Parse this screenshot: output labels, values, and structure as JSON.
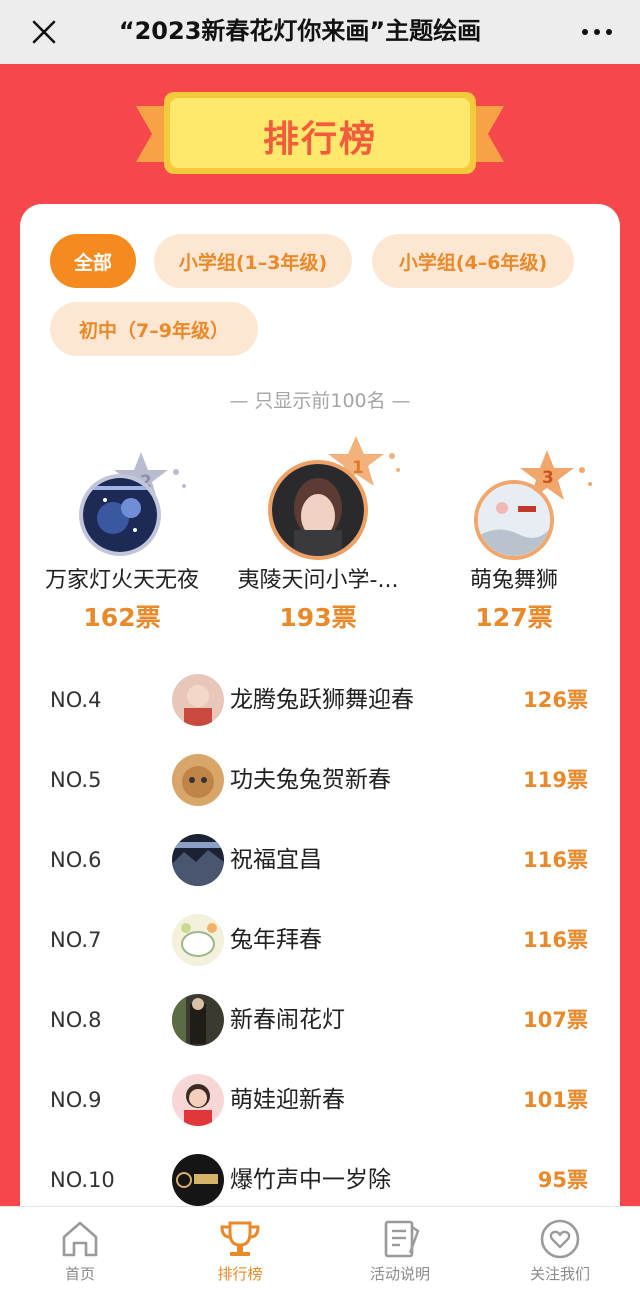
{
  "header": {
    "title": "“2023新春花灯你来画”主题绘画",
    "close_icon": "close-icon",
    "more_icon": "more-dots-icon"
  },
  "banner": {
    "title": "排行榜"
  },
  "filters": [
    {
      "label": "全部",
      "active": true
    },
    {
      "label": "小学组(1–3年级)",
      "active": false
    },
    {
      "label": "小学组(4–6年级)",
      "active": false
    },
    {
      "label": "初中（7–9年级）",
      "active": false
    }
  ],
  "note": "— 只显示前100名 —",
  "podium": [
    {
      "rank": "2",
      "name": "万家灯火天无夜",
      "votes": "162票"
    },
    {
      "rank": "1",
      "name": "夷陵天问小学-...",
      "votes": "193票"
    },
    {
      "rank": "3",
      "name": "萌兔舞狮",
      "votes": "127票"
    }
  ],
  "list": [
    {
      "rank": "NO.4",
      "title": "龙腾兔跃狮舞迎春",
      "votes": "126票"
    },
    {
      "rank": "NO.5",
      "title": "功夫兔兔贺新春",
      "votes": "119票"
    },
    {
      "rank": "NO.6",
      "title": "祝福宜昌",
      "votes": "116票"
    },
    {
      "rank": "NO.7",
      "title": "兔年拜春",
      "votes": "116票"
    },
    {
      "rank": "NO.8",
      "title": "新春闹花灯",
      "votes": "107票"
    },
    {
      "rank": "NO.9",
      "title": "萌娃迎新春",
      "votes": "101票"
    },
    {
      "rank": "NO.10",
      "title": "爆竹声中一岁除",
      "votes": "95票"
    }
  ],
  "tabs": [
    {
      "label": "首页",
      "icon": "home-icon",
      "active": false
    },
    {
      "label": "排行榜",
      "icon": "trophy-icon",
      "active": true
    },
    {
      "label": "活动说明",
      "icon": "document-icon",
      "active": false
    },
    {
      "label": "关注我们",
      "icon": "heart-icon",
      "active": false
    }
  ],
  "colors": {
    "background": "#f6484a",
    "accent": "#e9892a",
    "chip_active": "#f58a1f",
    "chip_inactive": "#fde7d2"
  }
}
